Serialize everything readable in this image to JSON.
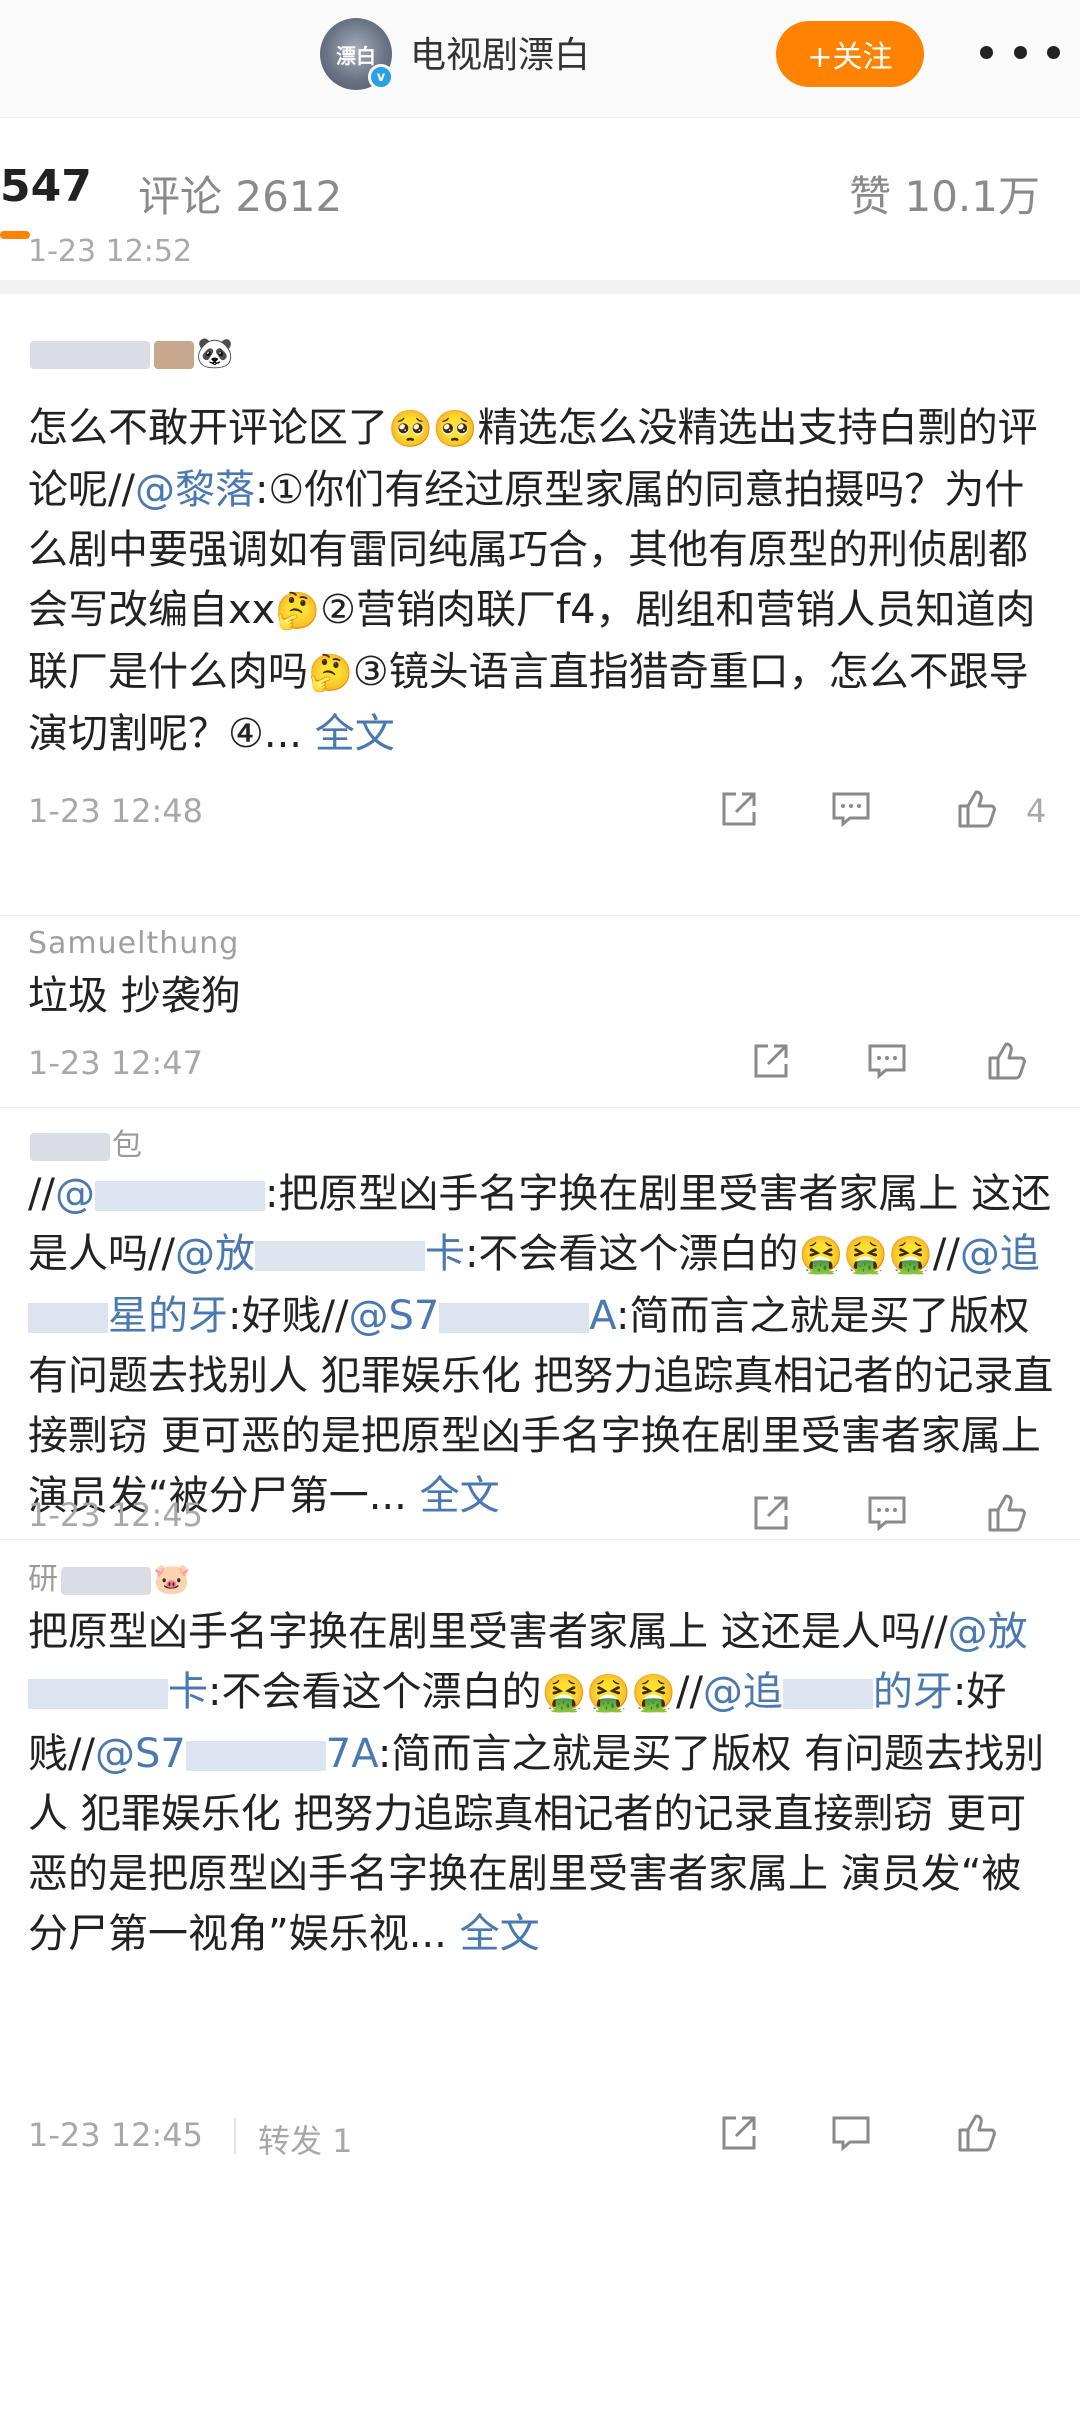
{
  "header": {
    "avatar_text": "漂白",
    "account_name": "电视剧漂白",
    "follow_label": "+关注"
  },
  "stats": {
    "reposts": "547",
    "comments": "评论 2612",
    "likes": "赞 10.1万"
  },
  "peek": {
    "time": "1-23 12:52"
  },
  "items": [
    {
      "text_a": "怎么不敢开评论区了",
      "text_b": "精选怎么没精选出支持白剽的评论呢//",
      "at_1": "@",
      "at_1b": "黎落",
      "text_c": ":①你们有经过原型家属的同意拍摄吗？为什么剧中要强调如有雷同纯属巧合，其他有原型的刑侦剧都会写改编自xx",
      "text_d": "②营销肉联厂f4，剧组和营销人员知道肉联厂是什么肉吗",
      "text_e": "③镜头语言直指猎奇重口，怎么不跟导演切割呢？④...",
      "more": "全文",
      "time": "1-23 12:48",
      "like_count": "4"
    },
    {
      "user": "Samuelthung",
      "text": "垃圾 抄袭狗",
      "time": "1-23 12:47"
    },
    {
      "user_tail": "包",
      "text_a": "//",
      "at_1": "@",
      "text_b": ":把原型凶手名字换在剧里受害者家属上 这还是人吗//",
      "at_2": "@放",
      "at_2b": "卡",
      "text_c": ":不会看这个漂白的",
      "text_d": "//",
      "at_3": "@追",
      "at_3b": "星的牙",
      "text_e": ":好贱//",
      "at_4": "@S7",
      "at_4b": "A",
      "text_f": ":简而言之就是买了版权 有问题去找别人 犯罪娱乐化 把努力追踪真相记者的记录直接剽窃 更可恶的是把原型凶手名字换在剧里受害者家属上 演员发“被分尸第一...",
      "more": "全文",
      "time": "1-23 12:45"
    },
    {
      "user_head": "研",
      "text_a": "把原型凶手名字换在剧里受害者家属上 这还是人吗//",
      "at_1": "@放",
      "at_1b": "卡",
      "text_b": ":不会看这个漂白的",
      "text_c": "//",
      "at_2": "@追",
      "at_2b": "的牙",
      "text_d": ":好贱//",
      "at_3": "@S7",
      "at_3b": "7A",
      "text_e": ":简而言之就是买了版权 有问题去找别人 犯罪娱乐化 把努力追踪真相记者的记录直接剽窃 更可恶的是把原型凶手名字换在剧里受害者家属上 演员发“被分尸第一视角”娱乐视...",
      "more": "全文",
      "time": "1-23 12:45",
      "repost_count": "转发 1"
    }
  ],
  "emoji": {
    "cry": "🥺",
    "think": "🤔",
    "sick": "🤮",
    "panda": "🐼",
    "pig": "🐷"
  },
  "icons": [
    "share-icon",
    "comment-icon",
    "like-icon"
  ]
}
